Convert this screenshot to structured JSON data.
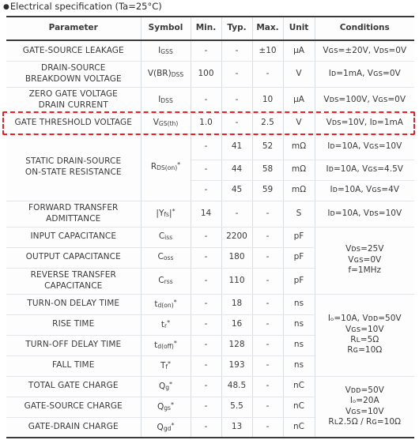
{
  "caption": {
    "bullet": "●",
    "text": "Electrical specification (Ta=25°C)"
  },
  "accent": {
    "highlight_color": "#ee1c24",
    "rule_color": "#3a3a3a",
    "grid_color": "#dde1e6"
  },
  "table": {
    "headers": [
      "Parameter",
      "Symbol",
      "Min.",
      "Typ.",
      "Max.",
      "Unit",
      "Conditions"
    ],
    "rows": [
      {
        "parameter": "GATE-SOURCE LEAKAGE",
        "symbol_main": "I",
        "symbol_sub": "GSS",
        "symbol_star": "",
        "min": "-",
        "typ": "-",
        "max": "±10",
        "unit": "μA",
        "conditions": "Vɢs=±20V, Vᴅs=0V",
        "highlight": false
      },
      {
        "parameter": "DRAIN-SOURCE\nBREAKDOWN VOLTAGE",
        "symbol_main": "V(BR)",
        "symbol_sub": "DSS",
        "symbol_star": "",
        "min": "100",
        "typ": "-",
        "max": "-",
        "unit": "V",
        "conditions": "Iᴅ=1mA, Vɢs=0V",
        "highlight": false
      },
      {
        "parameter": "ZERO GATE VOLTAGE\nDRAIN CURRENT",
        "symbol_main": "I",
        "symbol_sub": "DSS",
        "symbol_star": "",
        "min": "-",
        "typ": "-",
        "max": "10",
        "unit": "μA",
        "conditions": "Vᴅs=100V, Vɢs=0V",
        "highlight": false
      },
      {
        "parameter": "GATE THRESHOLD VOLTAGE",
        "symbol_main": "V",
        "symbol_sub": "GS(th)",
        "symbol_star": "",
        "min": "1.0",
        "typ": "-",
        "max": "2.5",
        "unit": "V",
        "conditions": "Vᴅs=10V, Iᴅ=1mA",
        "highlight": true
      },
      {
        "parameter": "STATIC DRAIN-SOURCE\nON-STATE RESISTANCE",
        "symbol_main": "R",
        "symbol_sub": "DS(on)",
        "symbol_star": "*",
        "min": "-",
        "typ": "41",
        "max": "52",
        "unit": "mΩ",
        "conditions": "Iᴅ=10A, Vɢs=10V",
        "highlight": false
      },
      {
        "parameter": "",
        "min": "-",
        "typ": "44",
        "max": "58",
        "unit": "mΩ",
        "conditions": "Iᴅ=10A, Vɢs=4.5V",
        "highlight": false
      },
      {
        "parameter": "",
        "min": "-",
        "typ": "45",
        "max": "59",
        "unit": "mΩ",
        "conditions": "Iᴅ=10A, Vɢs=4V",
        "highlight": false
      },
      {
        "parameter": "FORWARD TRANSFER\nADMITTANCE",
        "symbol_main": "|Y",
        "symbol_sub": "fs",
        "symbol_tail": "|",
        "symbol_star": "*",
        "min": "14",
        "typ": "-",
        "max": "-",
        "unit": "S",
        "conditions": "Iᴅ=10A, Vᴅs=10V",
        "highlight": false
      },
      {
        "parameter": "INPUT CAPACITANCE",
        "symbol_main": "C",
        "symbol_sub": "iss",
        "symbol_star": "",
        "min": "-",
        "typ": "2200",
        "max": "-",
        "unit": "pF",
        "highlight": false
      },
      {
        "parameter": "OUTPUT CAPACITANCE",
        "symbol_main": "C",
        "symbol_sub": "oss",
        "symbol_star": "",
        "min": "-",
        "typ": "180",
        "max": "-",
        "unit": "pF",
        "highlight": false
      },
      {
        "parameter": "REVERSE TRANSFER\nCAPACITANCE",
        "symbol_main": "C",
        "symbol_sub": "rss",
        "symbol_star": "",
        "min": "-",
        "typ": "110",
        "max": "-",
        "unit": "pF",
        "highlight": false
      },
      {
        "parameter": "TURN-ON DELAY TIME",
        "symbol_main": "t",
        "symbol_sub": "d(on)",
        "symbol_star": "*",
        "min": "-",
        "typ": "18",
        "max": "-",
        "unit": "ns",
        "highlight": false
      },
      {
        "parameter": "RISE TIME",
        "symbol_main": "t",
        "symbol_sub": "r",
        "symbol_star": "*",
        "min": "-",
        "typ": "16",
        "max": "-",
        "unit": "ns",
        "highlight": false
      },
      {
        "parameter": "TURN-OFF DELAY TIME",
        "symbol_main": "t",
        "symbol_sub": "d(off)",
        "symbol_star": "*",
        "min": "-",
        "typ": "128",
        "max": "-",
        "unit": "ns",
        "highlight": false
      },
      {
        "parameter": "FALL TIME",
        "symbol_main": "T",
        "symbol_sub": "f",
        "symbol_star": "*",
        "min": "-",
        "typ": "193",
        "max": "-",
        "unit": "ns",
        "highlight": false
      },
      {
        "parameter": "TOTAL GATE CHARGE",
        "symbol_main": "Q",
        "symbol_sub": "g",
        "symbol_star": "*",
        "min": "-",
        "typ": "48.5",
        "max": "-",
        "unit": "nC",
        "highlight": false
      },
      {
        "parameter": "GATE-SOURCE CHARGE",
        "symbol_main": "Q",
        "symbol_sub": "gs",
        "symbol_star": "*",
        "min": "-",
        "typ": "5.5",
        "max": "-",
        "unit": "nC",
        "highlight": false
      },
      {
        "parameter": "GATE-DRAIN CHARGE",
        "symbol_main": "Q",
        "symbol_sub": "gd",
        "symbol_star": "*",
        "min": "-",
        "typ": "13",
        "max": "-",
        "unit": "nC",
        "highlight": false
      }
    ],
    "merged_conditions": {
      "capacitance": "Vᴅs=25V\nVɢs=0V\nf=1MHz",
      "switching": "Iₒ=10A, Vᴅᴅ=50V\nVɢs=10V\nRʟ=5Ω\nRɢ=10Ω",
      "gate_charge": "Vᴅᴅ=50V\nIₒ=20A\nVɢs=10V\nRʟ2.5Ω / Rɢ=10Ω"
    }
  }
}
